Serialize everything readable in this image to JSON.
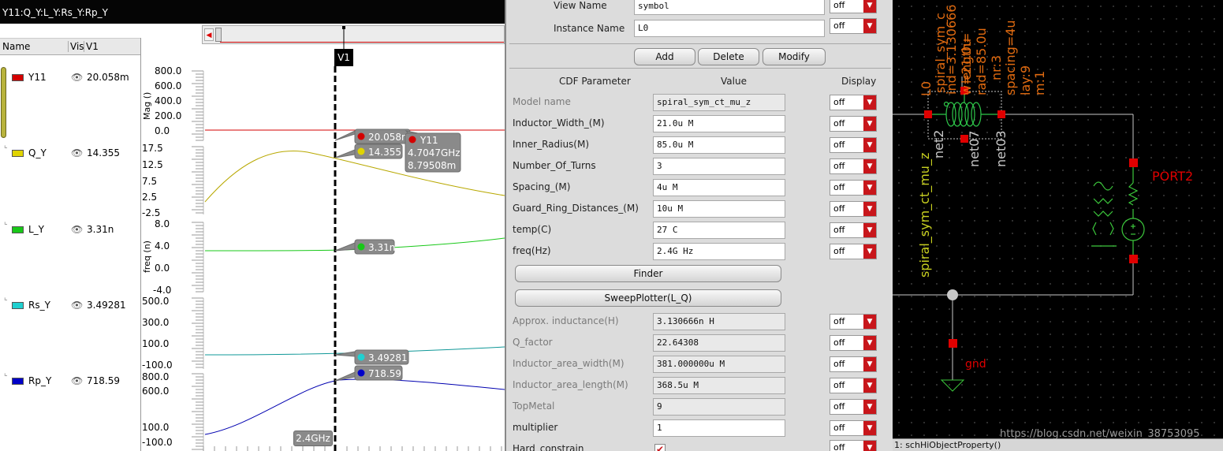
{
  "wave_window": {
    "title": "Y11:Q_Y:L_Y:Rs_Y:Rp_Y",
    "columns": {
      "name": "Name",
      "vis": "Vis",
      "v1": "V1"
    },
    "signals": [
      {
        "name": "Y11",
        "value": "20.058m",
        "color": "#d40000"
      },
      {
        "name": "Q_Y",
        "value": "14.355",
        "color": "#e0d400"
      },
      {
        "name": "L_Y",
        "value": "3.31n",
        "color": "#18c818"
      },
      {
        "name": "Rs_Y",
        "value": "3.49281",
        "color": "#20d0d0"
      },
      {
        "name": "Rp_Y",
        "value": "718.59",
        "color": "#0000c8"
      }
    ],
    "cursor_label": "V1",
    "cursor_freq": "2.4GHz",
    "subplots": [
      {
        "unit": "Mag ()",
        "ticks": [
          "800.0",
          "600.0",
          "400.0",
          "200.0",
          "0.0"
        ]
      },
      {
        "unit": "",
        "ticks": [
          "17.5",
          "12.5",
          "7.5",
          "2.5",
          "-2.5"
        ]
      },
      {
        "unit": "freq (n)",
        "ticks": [
          "8.0",
          "4.0",
          "0.0",
          "-4.0"
        ]
      },
      {
        "unit": "",
        "ticks": [
          "500.0",
          "300.0",
          "100.0",
          "-100.0"
        ]
      },
      {
        "unit": "",
        "ticks": [
          "800.0",
          "600.0",
          "100.0",
          "-100.0"
        ]
      }
    ],
    "markers": {
      "y11": "20.058m",
      "q": "14.355",
      "peak_name": "Y11",
      "peak_freq": "4.7047GHz",
      "peak_val": "8.79508m",
      "l": "3.31n",
      "rs": "3.49281",
      "rp": "718.59"
    }
  },
  "form": {
    "view_name_label": "View Name",
    "view_name_value": "symbol",
    "instance_name_label": "Instance Name",
    "instance_name_value": "L0",
    "off": "off",
    "btn_add": "Add",
    "btn_delete": "Delete",
    "btn_modify": "Modify",
    "hdr_param": "CDF Parameter",
    "hdr_value": "Value",
    "hdr_display": "Display",
    "params": [
      {
        "label": "Model name",
        "value": "spiral_sym_ct_mu_z",
        "ro": true,
        "dim": true
      },
      {
        "label": "Inductor_Width_(M)",
        "value": "21.0u M"
      },
      {
        "label": "Inner_Radius(M)",
        "value": "85.0u M"
      },
      {
        "label": "Number_Of_Turns",
        "value": "3"
      },
      {
        "label": "Spacing_(M)",
        "value": "4u M"
      },
      {
        "label": "Guard_Ring_Distances_(M)",
        "value": "10u M"
      },
      {
        "label": "temp(C)",
        "value": "27 C"
      },
      {
        "label": "freq(Hz)",
        "value": "2.4G Hz"
      }
    ],
    "btn_finder": "Finder",
    "btn_sweep": "SweepPlotter(L_Q)",
    "results": [
      {
        "label": "Approx. inductance(H)",
        "value": "3.130666n H",
        "ro": true,
        "dim": true
      },
      {
        "label": "Q_factor",
        "value": "22.64308",
        "ro": true,
        "dim": true
      },
      {
        "label": "Inductor_area_width(M)",
        "value": "381.000000u M",
        "ro": true,
        "dim": true
      },
      {
        "label": "Inductor_area_length(M)",
        "value": "368.5u M",
        "ro": true,
        "dim": true
      },
      {
        "label": "TopMetal",
        "value": "9",
        "ro": true,
        "dim": true
      },
      {
        "label": "multiplier",
        "value": "1"
      }
    ],
    "hard_constrain_label": "Hard_constrain"
  },
  "schematic": {
    "inst_name": "L0",
    "model": "spiral_sym_ct_mu_z",
    "model2": "spiral_sym_c",
    "ind_param": "ind=3.130666",
    "w_param": "w=21.0u",
    "rad_param": "rad=85.0u",
    "nr_param": "nr:3",
    "spacing_param": "spacing=4u",
    "lay_param": "lay:9",
    "m_param": "m:1",
    "length_frag": "length=",
    "net2": "net2",
    "net07": "net07",
    "net03": "net03",
    "port_label": "PORT2",
    "gnd_label": "gnd",
    "status": "1: schHiObjectProperty()"
  },
  "colors": {
    "wire": "#c8c8c8",
    "inductor": "#2ec84a",
    "label_orange": "#e06a10",
    "label_yellow": "#c8d020",
    "pin": "#e00000",
    "source": "#3cc83c"
  },
  "watermark": "https://blog.csdn.net/weixin_38753095"
}
